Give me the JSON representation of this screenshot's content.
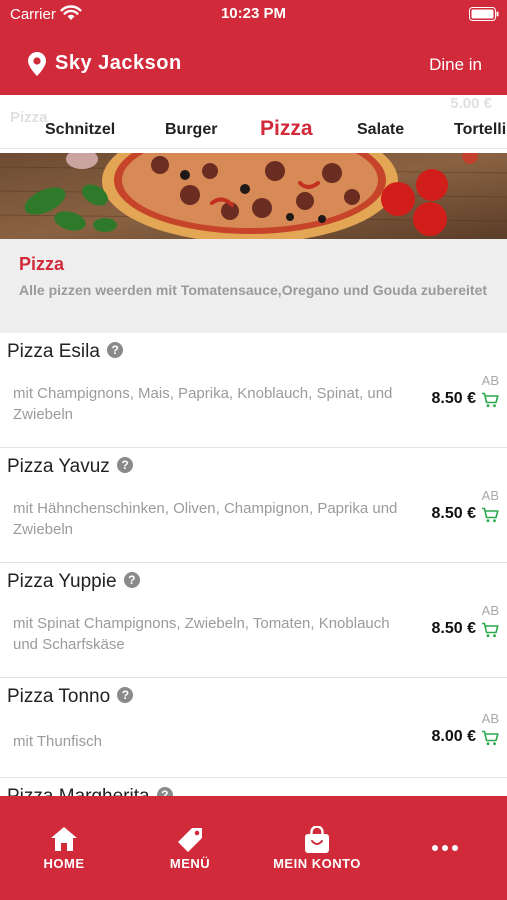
{
  "status_bar": {
    "carrier": "Carrier",
    "time": "10:23 PM"
  },
  "header": {
    "location": "Sky Jackson",
    "mode": "Dine in"
  },
  "ghost": {
    "left": "Pizza",
    "right": "5.00 €"
  },
  "tabs": [
    {
      "label": "Schnitzel",
      "active": false
    },
    {
      "label": "Burger",
      "active": false
    },
    {
      "label": "Pizza",
      "active": true
    },
    {
      "label": "Salate",
      "active": false
    },
    {
      "label": "Tortelli",
      "active": false
    }
  ],
  "category": {
    "title": "Pizza",
    "description": "Alle pizzen weerden mit Tomatensauce,Oregano und Gouda zubereitet"
  },
  "items": [
    {
      "name": "Pizza Esila",
      "info": "?",
      "description": "mit Champignons, Mais, Paprika, Knoblauch, Spinat, und Zwiebeln",
      "ab": "AB",
      "price": "8.50 €"
    },
    {
      "name": "Pizza Yavuz",
      "info": "?",
      "description": "mit Hähnchenschinken, Oliven, Champignon, Paprika und Zwiebeln",
      "ab": "AB",
      "price": "8.50 €"
    },
    {
      "name": "Pizza Yuppie",
      "info": "?",
      "description": "mit Spinat Champignons, Zwiebeln, Tomaten, Knoblauch und Scharfskäse",
      "ab": "AB",
      "price": "8.50 €"
    },
    {
      "name": "Pizza Tonno",
      "info": "?",
      "description": "mit Thunfisch",
      "ab": "AB",
      "price": "8.00 €"
    },
    {
      "name": "Pizza Margherita",
      "info": "?",
      "description": "",
      "ab": "",
      "price": ""
    }
  ],
  "bottom_nav": [
    {
      "label": "HOME",
      "icon": "home-icon"
    },
    {
      "label": "MENÜ",
      "icon": "tag-icon"
    },
    {
      "label": "MEIN KONTO",
      "icon": "bag-icon"
    },
    {
      "label": "",
      "icon": "more-icon"
    }
  ],
  "colors": {
    "brand": "#d12a3a",
    "cart": "#2aa84a",
    "info": "#8a8a8a"
  }
}
